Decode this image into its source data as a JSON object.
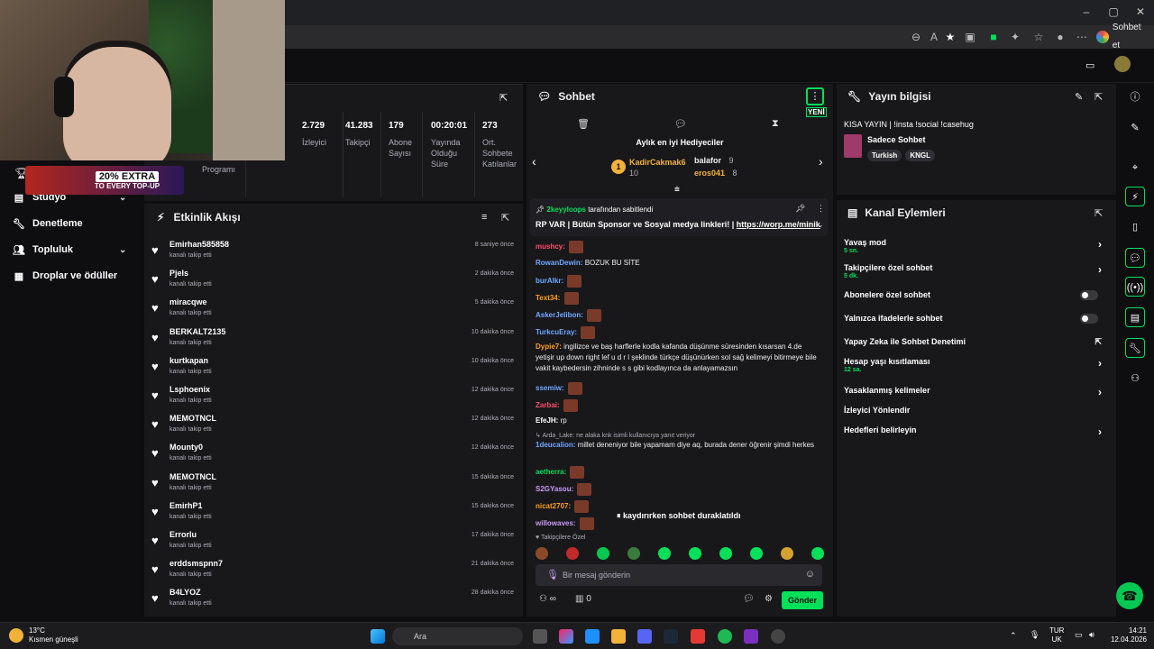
{
  "browser": {
    "address_icons": [
      "zoom-icon",
      "read-aloud-icon",
      "star-icon",
      "extension-icon",
      "extension-icon",
      "extension-icon",
      "favorites-icon",
      "collections-icon",
      "profile-icon",
      "more-icon"
    ],
    "copilot_label": "Sohbet et"
  },
  "promo": {
    "big": "20% EXTRA",
    "small": "TO EVERY TOP-UP"
  },
  "left_nav": [
    {
      "label": "Stüdyo",
      "has_chevron": true
    },
    {
      "label": "Denetleme",
      "has_chevron": false
    },
    {
      "label": "Topluluk",
      "has_chevron": true
    },
    {
      "label": "Droplar ve ödüller",
      "has_chevron": false
    }
  ],
  "stats": {
    "partial_label": "Programı",
    "items": [
      {
        "value": "2.729",
        "label": "İzleyici"
      },
      {
        "value": "41.283",
        "label": "Takipçi"
      },
      {
        "value": "179",
        "label": "Abone Sayısı"
      },
      {
        "value": "00:20:01",
        "label": "Yayında Olduğu Süre"
      },
      {
        "value": "273",
        "label": "Ort. Sohbete Katılanlar"
      }
    ]
  },
  "feed": {
    "title": "Etkinlik Akışı",
    "items": [
      {
        "name": "Emirhan585858",
        "sub": "kanalı takip etti",
        "time": "8 saniye önce"
      },
      {
        "name": "Pjels",
        "sub": "kanalı takip etti",
        "time": "2 dakika önce"
      },
      {
        "name": "miracqwe",
        "sub": "kanalı takip etti",
        "time": "5 dakika önce"
      },
      {
        "name": "BERKALT2135",
        "sub": "kanalı takip etti",
        "time": "10 dakika önce"
      },
      {
        "name": "kurtkapan",
        "sub": "kanalı takip etti",
        "time": "10 dakika önce"
      },
      {
        "name": "Lsphoenix",
        "sub": "kanalı takip etti",
        "time": "12 dakika önce"
      },
      {
        "name": "MEMOTNCL",
        "sub": "kanalı takip etti",
        "time": "12 dakika önce"
      },
      {
        "name": "Mounty0",
        "sub": "kanalı takip etti",
        "time": "12 dakika önce"
      },
      {
        "name": "MEMOTNCL",
        "sub": "kanalı takip etti",
        "time": "15 dakika önce"
      },
      {
        "name": "EmirhP1",
        "sub": "kanalı takip etti",
        "time": "15 dakika önce"
      },
      {
        "name": "Errorlu",
        "sub": "kanalı takip etti",
        "time": "17 dakika önce"
      },
      {
        "name": "erddsmspnn7",
        "sub": "kanalı takip etti",
        "time": "21 dakika önce"
      },
      {
        "name": "B4LYOZ",
        "sub": "kanalı takip etti",
        "time": "28 dakika önce"
      }
    ]
  },
  "chat": {
    "title": "Sohbet",
    "new_badge": "YENİ",
    "gifters_title": "Aylık en iyi Hediyeciler",
    "gifters": [
      {
        "rank": "1",
        "name": "KadirCakmak6",
        "count": "10"
      },
      {
        "name": "balafor",
        "count": "9"
      },
      {
        "name": "eros041",
        "count": "8"
      }
    ],
    "pinned": {
      "by": "2keyyloops",
      "by_suffix": "tarafından sabitlendi",
      "text": "RP VAR | Bütün Sponsor ve Sosyal medya linkleri! |",
      "link": "https://worp.me/minik"
    },
    "messages": [
      {
        "user": "mushcy:",
        "color": "#ff4d6d",
        "text": "",
        "emote": true
      },
      {
        "user": "RowanDewin:",
        "color": "#6fa8ff",
        "text": "BOZUK BU SİTE",
        "emote": false
      },
      {
        "user": "burAlkr:",
        "color": "#6fa8ff",
        "text": "",
        "emote": true
      },
      {
        "user": "Text34:",
        "color": "#ff9f1c",
        "text": "",
        "emote": true
      },
      {
        "user": "AskerJelibon:",
        "color": "#6fa8ff",
        "text": "",
        "emote": true
      },
      {
        "user": "TurkcuEray:",
        "color": "#6fa8ff",
        "text": "",
        "emote": true
      },
      {
        "user": "Dypie7:",
        "color": "#ff9f1c",
        "text": "ingilizce ve baş harflerle kodla kafanda düşünme süresinden kısarsan 4.de yetişir up down right lef u d r l şeklinde türkçe düşünürken sol sağ kelimeyi bitirmeye bile vakit kaybedersin zihninde s s gibi kodlayınca da anlayamazsın",
        "emote": false
      },
      {
        "user": "ssemiw:",
        "color": "#6fa8ff",
        "text": "",
        "emote": true
      },
      {
        "user": "Zarbai:",
        "color": "#ff4d6d",
        "text": "",
        "emote": true
      },
      {
        "user": "EfeJH:",
        "color": "#fff",
        "text": "rp",
        "emote": false
      },
      {
        "reply": "Arda_Lake: ne alaka knk isimli kullanıcıya yanıt veriyor"
      },
      {
        "user": "1deucalion:",
        "color": "#6fa8ff",
        "text": "millet deneniyor bile yapamam diye aq, burada dener öğrenir şimdi herkes",
        "emote": false
      },
      {
        "user": "aetherra:",
        "color": "#00e05a",
        "text": "",
        "emote": true
      },
      {
        "user": "S2GYasou:",
        "color": "#c89bf5",
        "text": "",
        "emote": true
      },
      {
        "user": "nicat2707:",
        "color": "#ff9f1c",
        "text": "",
        "emote": true
      },
      {
        "user": "willowaves:",
        "color": "#c89bf5",
        "text": "",
        "emote": true
      }
    ],
    "paused_text": "kaydırırken sohbet duraklatıldı",
    "followers_only": "Takipçilere Özel",
    "input_placeholder": "Bir mesaj gönderin",
    "bottom_count": "0",
    "send_label": "Gönder"
  },
  "info": {
    "title": "Yayın bilgisi",
    "stream_title": "KISA YAYIN | !insta !social !casehug",
    "category": "Sadece Sohbet",
    "tags": [
      "Turkish",
      "KNGL"
    ]
  },
  "actions": {
    "title": "Kanal Eylemleri",
    "items": [
      {
        "label": "Yavaş mod",
        "sub": "5 sn.",
        "control": "arrow"
      },
      {
        "label": "Takipçilere özel sohbet",
        "sub": "5 dk.",
        "control": "arrow"
      },
      {
        "label": "Abonelere özel sohbet",
        "sub": "",
        "control": "toggle"
      },
      {
        "label": "Yalnızca ifadelerle sohbet",
        "sub": "",
        "control": "toggle"
      },
      {
        "label": "Yapay Zeka ile Sohbet Denetimi",
        "sub": "",
        "control": "external"
      },
      {
        "label": "Hesap yaşı kısıtlaması",
        "sub": "12 sa.",
        "control": "arrow"
      },
      {
        "label": "Yasaklanmış kelimeler",
        "sub": "",
        "control": "arrow"
      },
      {
        "label": "İzleyici Yönlendir",
        "sub": "",
        "control": "none"
      },
      {
        "label": "Hedefleri belirleyin",
        "sub": "",
        "control": "arrow"
      }
    ]
  },
  "taskbar": {
    "temp": "13°C",
    "weather": "Kısmen güneşli",
    "search": "Ara",
    "lang_top": "TUR",
    "lang_bottom": "UK",
    "time": "14:21",
    "date": "12.04.2026"
  }
}
